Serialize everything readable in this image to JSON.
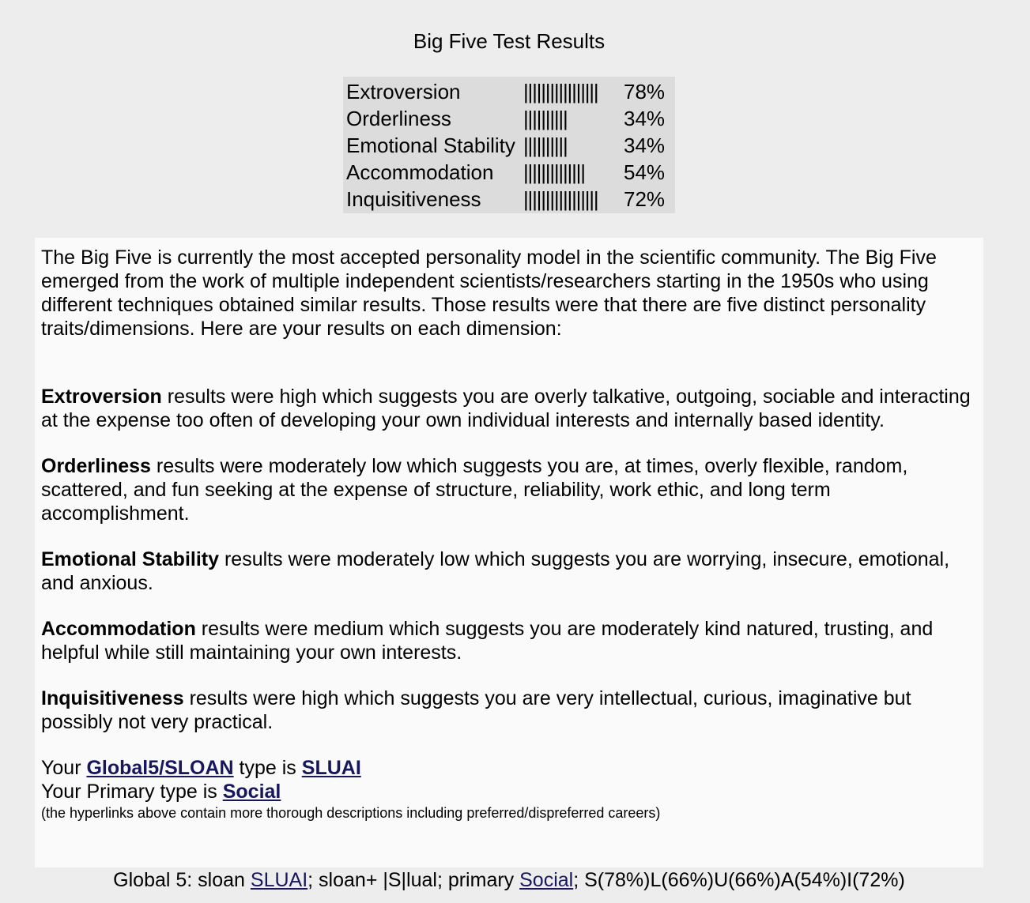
{
  "title": "Big Five Test Results",
  "scores": [
    {
      "name": "Extroversion",
      "bars": "|||||||||||||||||",
      "percent": "78%"
    },
    {
      "name": "Orderliness",
      "bars": "||||||||||",
      "percent": "34%"
    },
    {
      "name": "Emotional Stability",
      "bars": "||||||||||",
      "percent": "34%"
    },
    {
      "name": "Accommodation",
      "bars": "||||||||||||||",
      "percent": "54%"
    },
    {
      "name": "Inquisitiveness",
      "bars": "|||||||||||||||||",
      "percent": "72%"
    }
  ],
  "intro": "The Big Five is currently the most accepted personality model in the scientific community. The Big Five emerged from the work of multiple independent scientists/researchers starting in the 1950s who using different techniques obtained similar results. Those results were that there are five distinct personality traits/dimensions. Here are your results on each dimension:",
  "traits": [
    {
      "name": "Extroversion",
      "text": " results were high which suggests you are overly talkative, outgoing, sociable and interacting at the expense too often of developing your own individual interests and internally based identity."
    },
    {
      "name": "Orderliness",
      "text": " results were moderately low which suggests you are, at times, overly flexible, random, scattered, and fun seeking at the expense of structure, reliability, work ethic, and long term accomplishment."
    },
    {
      "name": "Emotional Stability",
      "text": " results were moderately low which suggests you are worrying, insecure, emotional, and anxious."
    },
    {
      "name": "Accommodation",
      "text": " results were medium which suggests you are moderately kind natured, trusting, and helpful while still maintaining your own interests."
    },
    {
      "name": "Inquisitiveness",
      "text": " results were high which suggests you are very intellectual, curious, imaginative but possibly not very practical."
    }
  ],
  "type_line": {
    "prefix": "Your ",
    "link": "Global5/SLOAN",
    "middle": " type is ",
    "type": "SLUAI"
  },
  "primary_line": {
    "prefix": "Your Primary type is ",
    "link": "Social"
  },
  "note": "(the hyperlinks above contain more thorough descriptions including preferred/dispreferred careers)",
  "footer": {
    "prefix": "Global 5: sloan ",
    "sloan_link": "SLUAI",
    "middle": "; sloan+ |S|lual; primary ",
    "primary_link": "Social",
    "suffix": "; S(78%)L(66%)U(66%)A(54%)I(72%)"
  },
  "colors": {
    "page_background": "#ededed",
    "table_background": "#dcdcdc",
    "content_background": "#fafafa",
    "link": "#17175e"
  }
}
